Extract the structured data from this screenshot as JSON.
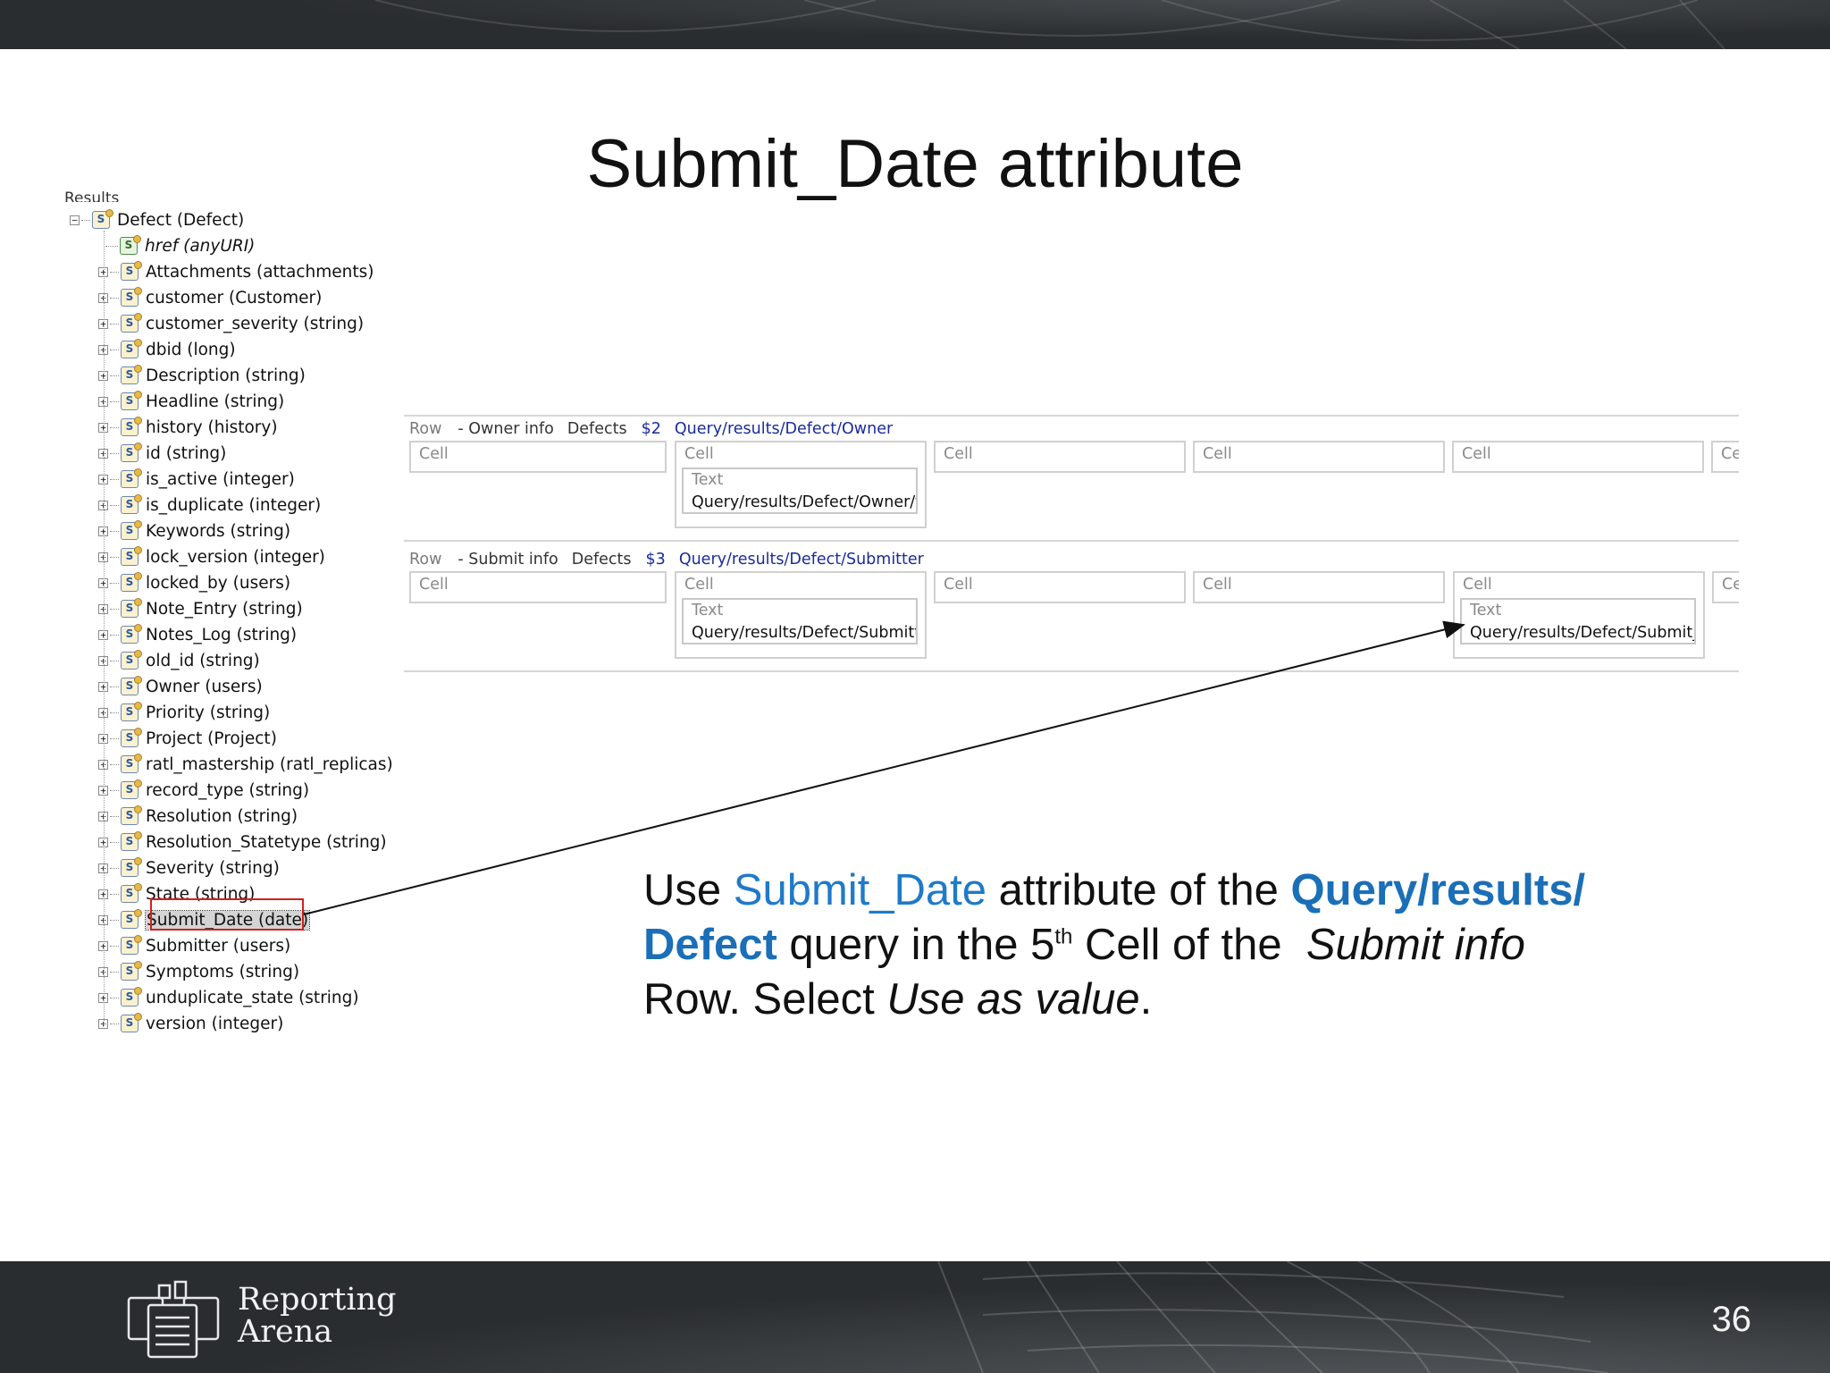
{
  "slide": {
    "title": "Submit_Date attribute",
    "page_number": "36"
  },
  "tree": {
    "clipped_label": "Results",
    "root": "Defect (Defect)",
    "href": "href (anyURI)",
    "items": [
      "Attachments (attachments)",
      "customer (Customer)",
      "customer_severity (string)",
      "dbid (long)",
      "Description (string)",
      "Headline (string)",
      "history (history)",
      "id (string)",
      "is_active (integer)",
      "is_duplicate (integer)",
      "Keywords (string)",
      "lock_version (integer)",
      "locked_by (users)",
      "Note_Entry (string)",
      "Notes_Log (string)",
      "old_id (string)",
      "Owner (users)",
      "Priority (string)",
      "Project (Project)",
      "ratl_mastership (ratl_replicas)",
      "record_type (string)",
      "Resolution (string)",
      "Resolution_Statetype (string)",
      "Severity (string)",
      "State (string)",
      "Submit_Date (date)",
      "Submitter (users)",
      "Symptoms (string)",
      "unduplicate_state (string)",
      "version (integer)"
    ],
    "selected_index": 25
  },
  "rows": [
    {
      "row_word": "Row",
      "name": "- Owner info",
      "dataset": "Defects",
      "var": "$2",
      "query": "Query/results/Defect/Owner",
      "cells": [
        "Cell",
        "Cell",
        "Cell",
        "Cell",
        "Cell",
        "Ce"
      ],
      "text_label": "Text",
      "text_value": "Query/results/Defect/Owner/fu"
    },
    {
      "row_word": "Row",
      "name": "- Submit info",
      "dataset": "Defects",
      "var": "$3",
      "query": "Query/results/Defect/Submitter",
      "cells": [
        "Cell",
        "Cell",
        "Cell",
        "Cell",
        "Cell",
        "Ce"
      ],
      "text_label": "Text",
      "text_value": "Query/results/Defect/Submitter",
      "text_label_5": "Text",
      "text_value_5": "Query/results/Defect/Submit_D"
    }
  ],
  "instruction": {
    "p1": "Use ",
    "p2": "Submit_Date",
    "p3": " attribute of the ",
    "p4": "Query/results/",
    "p5": "Defect",
    "p6": " query in the 5",
    "p7": "th",
    "p8": " Cell of the  ",
    "p9": "Submit info",
    "p10": "Row. Select ",
    "p11": "Use as value",
    "p12": "."
  },
  "logo": {
    "line1": "Reporting",
    "line2": "Arena"
  },
  "colors": {
    "accent": "#1f7ac8",
    "dark_bar": "#2a2d30",
    "highlight": "#d02020",
    "query_blue": "#1a2b9a"
  }
}
